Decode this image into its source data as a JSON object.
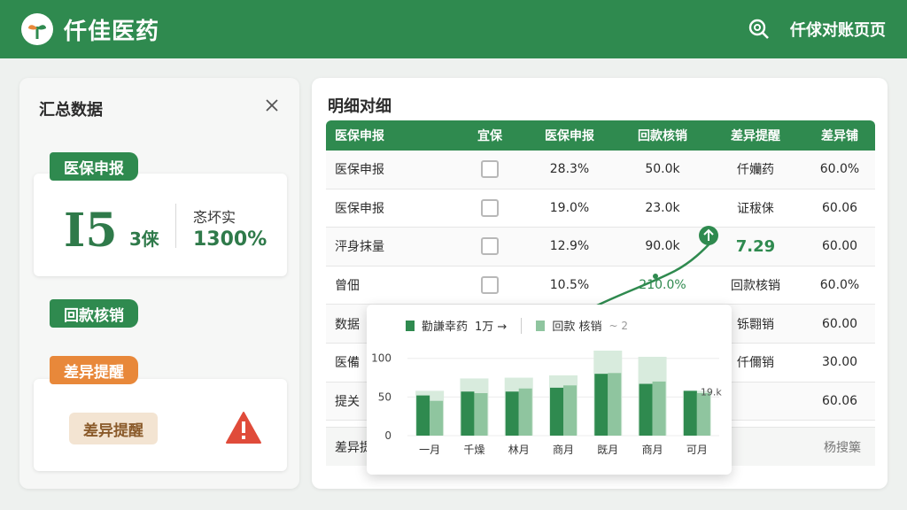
{
  "header": {
    "brand": "仟佳医药",
    "title_right": "仟俅对账页页"
  },
  "left": {
    "title": "汇总数据",
    "card1": {
      "tag": "医保申报",
      "number": "I5",
      "unit": "3俫",
      "stat_label": "忞坏实",
      "stat_value": "1300%"
    },
    "tag2": "回款核销",
    "tag3": "差异提醒",
    "warn_badge": "差异提醒"
  },
  "right": {
    "title": "明细对细",
    "headers": [
      "医保申报",
      "宜保",
      "医保申报",
      "回款核销",
      "差异提醒",
      "差异铺"
    ],
    "rows": [
      {
        "c1": "医保申报",
        "c3": "28.3%",
        "c4": "50.0k",
        "c5": "仟孏药",
        "c6": "60.0%"
      },
      {
        "c1": "医保申报",
        "c3": "19.0%",
        "c4": "23.0k",
        "c5": "证秡俫",
        "c6": "60.06"
      },
      {
        "c1": "泙身抹量",
        "c3": "12.9%",
        "c4": "90.0k",
        "c5": "7.29",
        "c6": "60.00"
      },
      {
        "c1": "曾佃",
        "c3": "10.5%",
        "c4": "210.0%",
        "c5": "回款核销",
        "c6": "60.0%"
      },
      {
        "c1": "数据",
        "c3": "",
        "c4": "",
        "c5": "铄翾销",
        "c6": "60.00"
      },
      {
        "c1": "医備",
        "c3": "",
        "c4": "",
        "c5": "仟儞销",
        "c6": "30.00"
      },
      {
        "c1": "提关",
        "c3": "",
        "c4": "",
        "c5": "",
        "c6": "60.06"
      }
    ],
    "footer_left": "差异提",
    "footer_right": "杨搜篥"
  },
  "chart_legend": {
    "series1": "勸謙幸药",
    "series1_extra": "1万 →",
    "series2": "回款 核销",
    "extra": "~ 2"
  },
  "chart_data": {
    "type": "bar",
    "categories": [
      "一月",
      "千燥",
      "林月",
      "商月",
      "既月",
      "商月",
      "可月"
    ],
    "series": [
      {
        "values": [
          52,
          57,
          57,
          62,
          80,
          67,
          58
        ],
        "color": "#2f8a4f"
      },
      {
        "values": [
          45,
          55,
          61,
          65,
          81,
          70,
          55
        ],
        "color": "#8fc59f"
      }
    ],
    "totals": [
      58,
      74,
      75,
      78,
      110,
      102,
      58
    ],
    "ylim": [
      0,
      110
    ],
    "yticks": [
      0,
      50,
      100
    ],
    "annotation": "19.k"
  },
  "colors": {
    "primary": "#2f8a4f",
    "light": "#8fc59f",
    "warning": "#e04b3a",
    "orange": "#e8883a"
  }
}
